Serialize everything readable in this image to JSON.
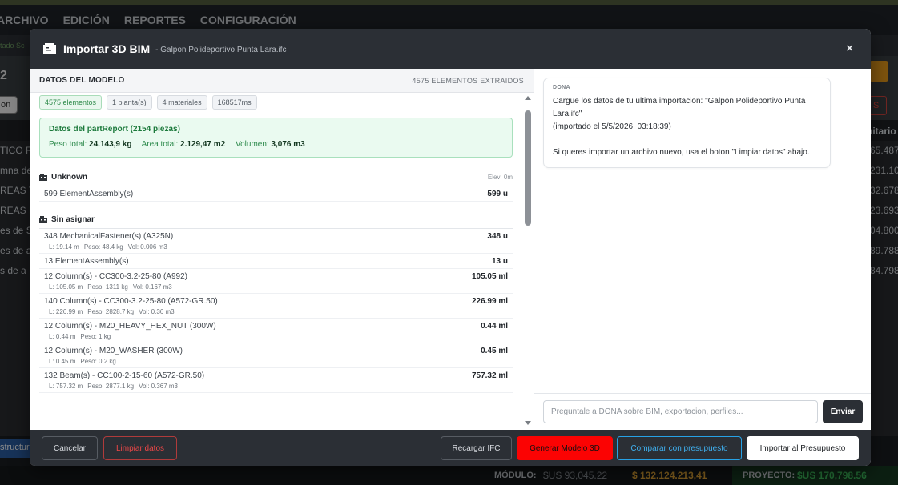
{
  "background": {
    "menu": [
      "ARCHIVO",
      "EDICIÓN",
      "REPORTES",
      "CONFIGURACIÓN"
    ],
    "sub_text": "tado  Sc",
    "number": "2",
    "button_fragment": "on",
    "red_fragment": "S",
    "table_header_right": "nitario",
    "left_rows": [
      "TICO RE",
      "mna de",
      "REAS T",
      "REAS L",
      "es de S",
      "es de a",
      "s de a"
    ],
    "right_rows": [
      "65.487",
      "231.10",
      "32.678",
      "23.693",
      "04.800",
      "89.788",
      "84.798"
    ],
    "tab_fragment": "structura",
    "footer": {
      "modulo_label": "MÓDULO:",
      "modulo_usd": "$US 93,045.22",
      "modulo_ars": "$ 132.124.213,41",
      "proyecto_label": "PROYECTO:",
      "proyecto_usd": "$US 170,798.56"
    }
  },
  "modal": {
    "title": "Importar 3D BIM",
    "file": "- Galpon Polideportivo Punta Lara.ifc",
    "close_label": "×",
    "left": {
      "title": "DATOS DEL MODELO",
      "count": "4575 ELEMENTOS EXTRAIDOS",
      "badges": [
        "4575 elementos",
        "1 planta(s)",
        "4 materiales",
        "168517ms"
      ],
      "report": {
        "title": "Datos del partReport (2154 piezas)",
        "peso_label": "Peso total:",
        "peso": "24.143,9 kg",
        "area_label": "Area total:",
        "area": "2.129,47 m2",
        "vol_label": "Volumen:",
        "vol": "3,076 m3"
      },
      "groups": [
        {
          "name": "Unknown",
          "elev": "Elev: 0m",
          "items": [
            {
              "name": "599 ElementAssembly(s)",
              "qty": "599 u",
              "meta": []
            }
          ]
        },
        {
          "name": "Sin asignar",
          "elev": "",
          "items": [
            {
              "name": "348 MechanicalFastener(s) (A325N)",
              "qty": "348 u",
              "meta": [
                "L: 19.14 m",
                "Peso: 48.4 kg",
                "Vol: 0.006 m3"
              ]
            },
            {
              "name": "13 ElementAssembly(s)",
              "qty": "13 u",
              "meta": []
            },
            {
              "name": "12 Column(s) - CC300-3.2-25-80 (A992)",
              "qty": "105.05 ml",
              "meta": [
                "L: 105.05 m",
                "Peso: 1311 kg",
                "Vol: 0.167 m3"
              ]
            },
            {
              "name": "140 Column(s) - CC300-3.2-25-80 (A572-GR.50)",
              "qty": "226.99 ml",
              "meta": [
                "L: 226.99 m",
                "Peso: 2828.7 kg",
                "Vol: 0.36 m3"
              ]
            },
            {
              "name": "12 Column(s) - M20_HEAVY_HEX_NUT (300W)",
              "qty": "0.44 ml",
              "meta": [
                "L: 0.44 m",
                "Peso: 1 kg"
              ]
            },
            {
              "name": "12 Column(s) - M20_WASHER (300W)",
              "qty": "0.45 ml",
              "meta": [
                "L: 0.45 m",
                "Peso: 0.2 kg"
              ]
            },
            {
              "name": "132 Beam(s) - CC100-2-15-60 (A572-GR.50)",
              "qty": "757.32 ml",
              "meta": [
                "L: 757.32 m",
                "Peso: 2877.1 kg",
                "Vol: 0.367 m3"
              ]
            }
          ]
        }
      ]
    },
    "chat": {
      "from": "DONA",
      "message": "Cargue los datos de tu ultima importacion: \"Galpon Polideportivo Punta Lara.ifc\"\n(importado el 5/5/2026, 03:18:39)\n\nSi queres importar un archivo nuevo, usa el boton \"Limpiar datos\" abajo.",
      "placeholder": "Preguntale a DONA sobre BIM, exportacion, perfiles...",
      "send_label": "Enviar"
    },
    "footer": {
      "cancel": "Cancelar",
      "clear": "Limpiar datos",
      "reload": "Recargar IFC",
      "generate": "Generar Modelo 3D",
      "compare": "Comparar con presupuesto",
      "import": "Importar al Presupuesto"
    }
  },
  "colors": {
    "header_bg": "#2b2f35",
    "generate_red": "#fb0303",
    "compare_blue": "#27a2e6",
    "report_green": "#1c7a3c"
  }
}
